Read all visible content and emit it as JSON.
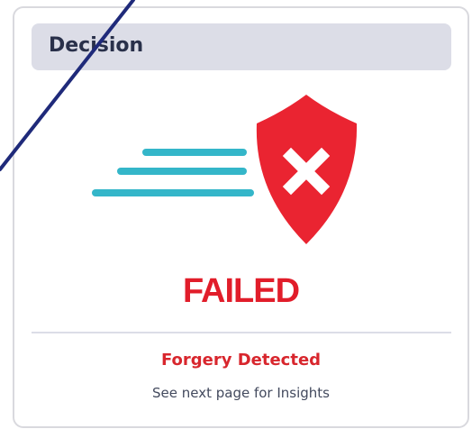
{
  "card": {
    "title": "Decision",
    "status": "FAILED",
    "reason": "Forgery Detected",
    "hint": "See next page for Insights"
  },
  "icons": {
    "status_icon": "shield-x-icon",
    "motion_lines": "speed-lines-icon"
  },
  "colors": {
    "header_bg": "#dcdde7",
    "title_text": "#29304a",
    "status_red": "#e11d2a",
    "shield_red": "#ea2431",
    "speed_lines": "#34b6c9",
    "hint_text": "#434a5e",
    "pen_stroke": "#1f2a7a"
  }
}
